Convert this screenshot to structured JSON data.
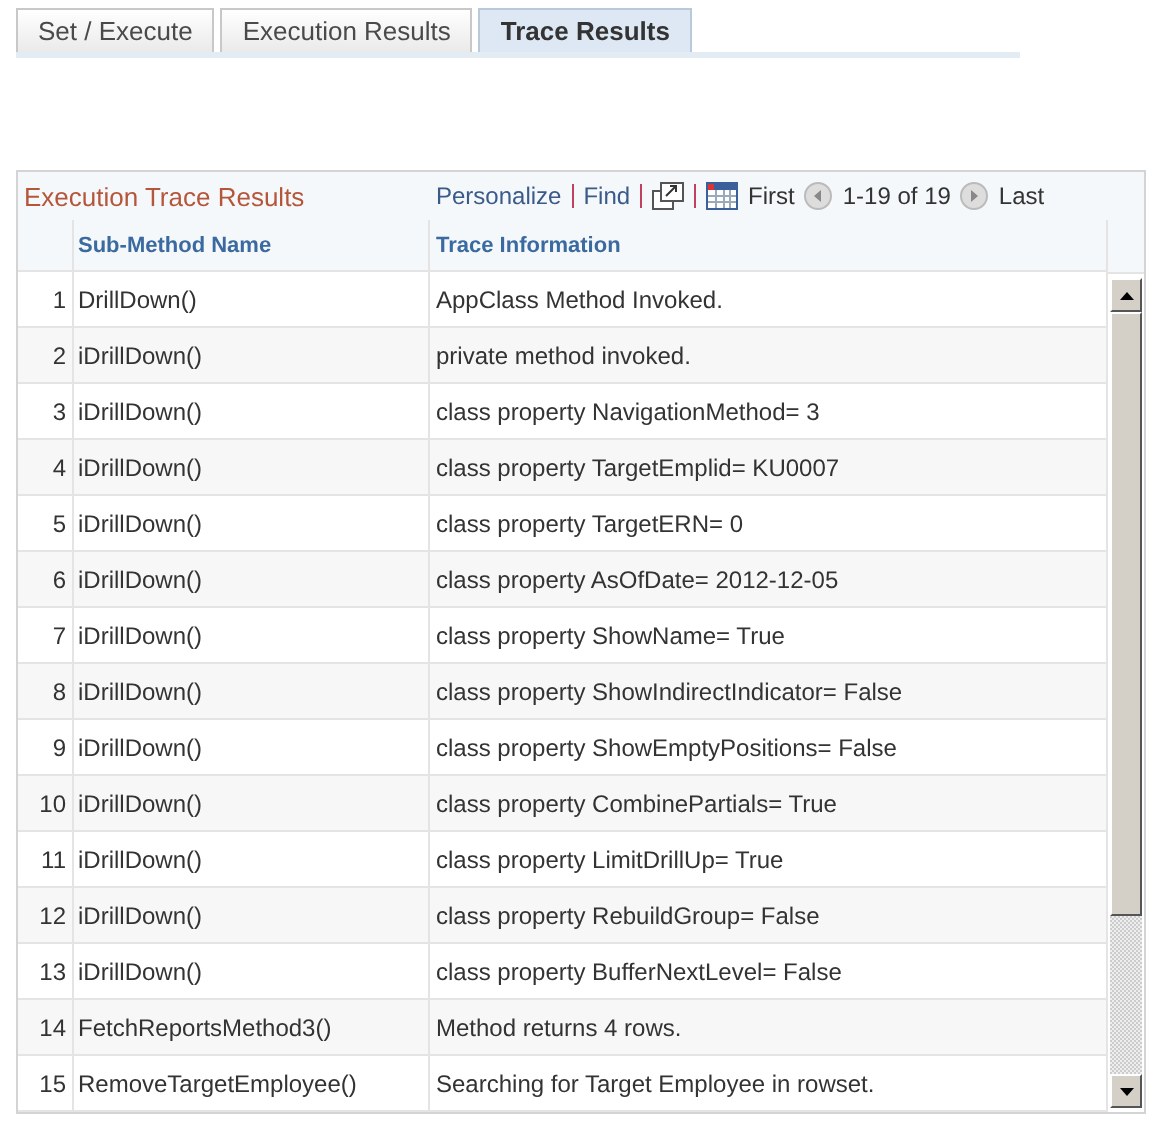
{
  "tabs": [
    {
      "label": "Set / Execute",
      "selected": false
    },
    {
      "label": "Execution Results",
      "selected": false
    },
    {
      "label": "Trace Results",
      "selected": true
    }
  ],
  "grid": {
    "title": "Execution Trace Results",
    "links": [
      "Personalize",
      "Find"
    ],
    "first": "First",
    "range": "1-19 of 19",
    "last": "Last",
    "columns": [
      "Sub-Method Name",
      "Trace Information"
    ],
    "rows": [
      {
        "n": "1",
        "name": "DrillDown()",
        "info": "AppClass Method Invoked."
      },
      {
        "n": "2",
        "name": "iDrillDown()",
        "info": "private method invoked."
      },
      {
        "n": "3",
        "name": "iDrillDown()",
        "info": "class property NavigationMethod= 3"
      },
      {
        "n": "4",
        "name": "iDrillDown()",
        "info": "class property TargetEmplid= KU0007"
      },
      {
        "n": "5",
        "name": "iDrillDown()",
        "info": "class property TargetERN= 0"
      },
      {
        "n": "6",
        "name": "iDrillDown()",
        "info": "class property AsOfDate= 2012-12-05"
      },
      {
        "n": "7",
        "name": "iDrillDown()",
        "info": "class property ShowName= True"
      },
      {
        "n": "8",
        "name": "iDrillDown()",
        "info": "class property ShowIndirectIndicator= False"
      },
      {
        "n": "9",
        "name": "iDrillDown()",
        "info": "class property ShowEmptyPositions= False"
      },
      {
        "n": "10",
        "name": "iDrillDown()",
        "info": "class property CombinePartials= True"
      },
      {
        "n": "11",
        "name": "iDrillDown()",
        "info": "class property LimitDrillUp= True"
      },
      {
        "n": "12",
        "name": "iDrillDown()",
        "info": "class property RebuildGroup= False"
      },
      {
        "n": "13",
        "name": "iDrillDown()",
        "info": "class property BufferNextLevel= False"
      },
      {
        "n": "14",
        "name": "FetchReportsMethod3()",
        "info": "Method returns 4 rows."
      },
      {
        "n": "15",
        "name": "RemoveTargetEmployee()",
        "info": "Searching for Target Employee in rowset."
      }
    ]
  }
}
